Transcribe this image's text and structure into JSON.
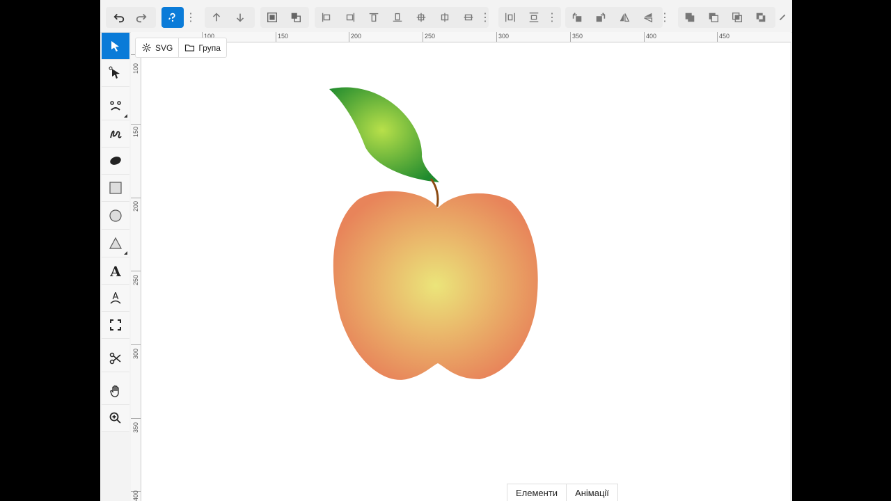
{
  "breadcrumb": [
    {
      "label": "SVG",
      "icon": "gear-icon"
    },
    {
      "label": "Група",
      "icon": "folder-icon"
    }
  ],
  "ruler": {
    "top_labels": [
      "100",
      "150",
      "200",
      "250",
      "300",
      "350",
      "400",
      "450"
    ],
    "left_labels": [
      "100",
      "150",
      "200",
      "250",
      "300",
      "350",
      "400"
    ]
  },
  "bottom_tabs": [
    "Елементи",
    "Анімації"
  ],
  "colors": {
    "accent": "#0a7bd8",
    "leaf_light": "#b8e04a",
    "leaf_dark": "#1f8a2e",
    "fruit_center": "#ebe57a",
    "fruit_edge": "#e8845a",
    "stem": "#8b4a12"
  },
  "toolbar_icons": [
    "undo-icon",
    "redo-icon",
    "help-icon",
    "more-icon",
    "move-up-icon",
    "move-down-icon",
    "bring-forward-icon",
    "send-backward-icon",
    "align-left-icon",
    "align-right-icon",
    "align-top-icon",
    "align-bottom-icon",
    "align-center-icon",
    "align-middle-icon",
    "distribute-icon",
    "distribute-h-icon",
    "distribute-v-icon",
    "rotate-left-icon",
    "rotate-right-icon",
    "flip-h-icon",
    "flip-v-icon",
    "union-icon",
    "subtract-icon",
    "intersect-icon",
    "exclude-icon"
  ],
  "tool_icons": [
    "select-icon",
    "node-select-icon",
    "face-icon",
    "freehand-icon",
    "ellipse-filled-icon",
    "rectangle-icon",
    "circle-icon",
    "triangle-icon",
    "text-icon",
    "text-path-icon",
    "crop-icon",
    "scissors-icon",
    "hand-icon",
    "zoom-in-icon"
  ]
}
